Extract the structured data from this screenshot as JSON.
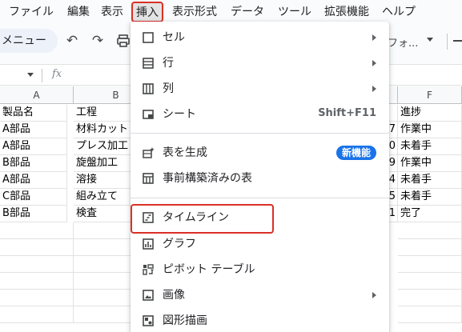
{
  "menubar": {
    "items": [
      "ファイル",
      "編集",
      "表示",
      "挿入",
      "表示形式",
      "データ",
      "ツール",
      "拡張機能",
      "ヘルプ"
    ],
    "active_index": 3
  },
  "toolbar": {
    "menu_label": "メニュー",
    "font_label": "フォ..."
  },
  "formula": {
    "fx_label": "fx"
  },
  "grid": {
    "columns": [
      "A",
      "B",
      "F"
    ],
    "rows": [
      {
        "a": "製品名",
        "b": "工程",
        "e": "",
        "f": "進捗"
      },
      {
        "a": "A部品",
        "b": "材料カット",
        "e": "7",
        "f": "作業中"
      },
      {
        "a": "A部品",
        "b": "プレス加工",
        "e": "0",
        "f": "未着手"
      },
      {
        "a": "B部品",
        "b": "旋盤加工",
        "e": "9",
        "f": "作業中"
      },
      {
        "a": "A部品",
        "b": "溶接",
        "e": "4",
        "f": "未着手"
      },
      {
        "a": "C部品",
        "b": "組み立て",
        "e": "5",
        "f": "未着手"
      },
      {
        "a": "B部品",
        "b": "検査",
        "e": "1",
        "f": "完了"
      }
    ]
  },
  "insert_menu": {
    "items": [
      {
        "label": "セル",
        "icon": "cell-icon",
        "submenu": true
      },
      {
        "label": "行",
        "icon": "row-icon",
        "submenu": true
      },
      {
        "label": "列",
        "icon": "column-icon",
        "submenu": true
      },
      {
        "label": "シート",
        "icon": "sheet-icon",
        "shortcut": "Shift+F11"
      },
      {
        "label": "表を生成",
        "icon": "sparkle-table-icon",
        "badge": "新機能"
      },
      {
        "label": "事前構築済みの表",
        "icon": "table-icon"
      },
      {
        "label": "タイムライン",
        "icon": "timeline-icon",
        "highlighted": true
      },
      {
        "label": "グラフ",
        "icon": "chart-icon"
      },
      {
        "label": "ピボット テーブル",
        "icon": "pivot-table-icon"
      },
      {
        "label": "画像",
        "icon": "image-icon",
        "submenu": true
      },
      {
        "label": "図形描画",
        "icon": "drawing-icon"
      }
    ]
  },
  "colors": {
    "highlight": "#d93025",
    "badge": "#1a73e8",
    "menu_bg": "#ffffff",
    "app_bg": "#f9fbfd"
  }
}
